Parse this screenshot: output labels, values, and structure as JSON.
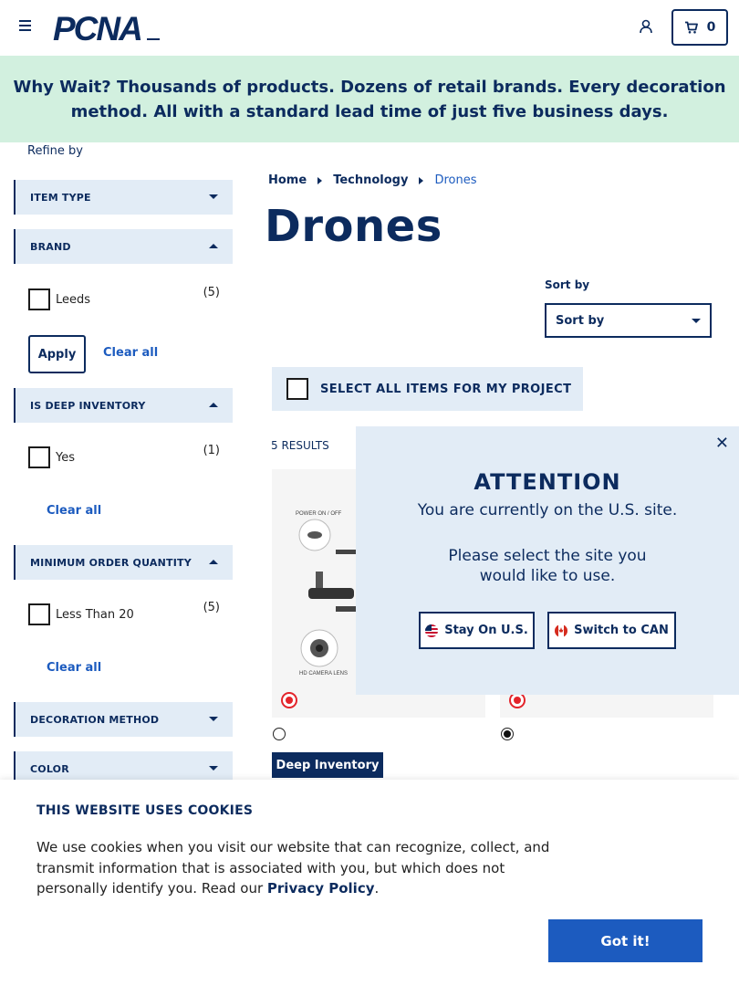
{
  "header": {
    "logo_text": "PCNA",
    "cart_count": "0",
    "icons": [
      "menu-icon",
      "account-icon",
      "cart-icon"
    ]
  },
  "promo": {
    "lead": "Why Wait?",
    "text": " Thousands of products. Dozens of retail brands. Every decoration method. All with a standard lead time of just five business days."
  },
  "sidebar": {
    "refine_label": "Refine by",
    "facets": [
      {
        "label": "ITEM TYPE",
        "expanded": false
      },
      {
        "label": "BRAND",
        "expanded": true
      },
      {
        "label": "IS DEEP INVENTORY",
        "expanded": true
      },
      {
        "label": "MINIMUM ORDER QUANTITY",
        "expanded": true
      },
      {
        "label": "DECORATION METHOD",
        "expanded": false
      },
      {
        "label": "COLOR",
        "expanded": false
      }
    ],
    "brand_options": [
      {
        "label": "Leeds",
        "count": "(5)",
        "checked": false
      }
    ],
    "deep_options": [
      {
        "label": "Yes",
        "count": "(1)",
        "checked": false
      }
    ],
    "moq_options": [
      {
        "label": "Less Than 20",
        "count": "(5)",
        "checked": false
      }
    ],
    "apply_label": "Apply",
    "clear_label": "Clear all"
  },
  "breadcrumb": [
    "Home",
    "Technology",
    "Drones"
  ],
  "main": {
    "title": "Drones",
    "sort_label": "Sort by",
    "sort_value": "Sort by",
    "select_all_label": "SELECT ALL ITEMS FOR MY PROJECT",
    "results": "5 RESULTS",
    "product_image_labels": [
      "POWER ON / OFF",
      "HD CAMERA LENS"
    ],
    "deep_inventory_badge": "Deep Inventory"
  },
  "attention_modal": {
    "title": "ATTENTION",
    "line1": "You are currently on the U.S. site.",
    "line2": "Please select the site you",
    "line3": "would like to use.",
    "stay_label": "Stay On U.S.",
    "switch_label": "Switch to CAN",
    "close_glyph": "✕"
  },
  "cookie_banner": {
    "title": "THIS WEBSITE USES COOKIES",
    "text": "We use cookies when you visit our website that can recognize, collect, and transmit information that is associated with you, but which does not personally identify you. Read our ",
    "link": "Privacy Policy",
    "suffix": ".",
    "button": "Got it!"
  },
  "colors": {
    "navy": "#0c2b5e",
    "link_blue": "#1c5bbf",
    "promo_bg": "#d2f0df",
    "panel_bg": "#e2ecf6",
    "badge_red": "#e3242b"
  }
}
